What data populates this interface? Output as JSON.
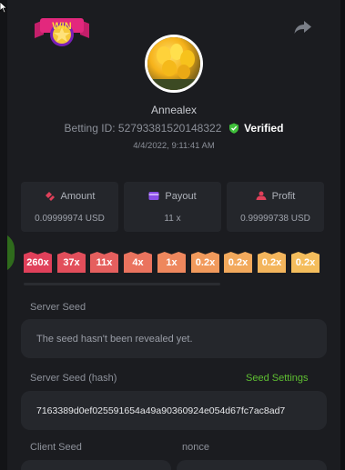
{
  "header": {
    "logo_text": "WIN",
    "share_icon": "share-icon"
  },
  "profile": {
    "username": "Annealex",
    "betting_id_label": "Betting ID:",
    "betting_id": "52793381520148322",
    "verified_label": "Verified",
    "date": "4/4/2022, 9:11:41 AM"
  },
  "stats": [
    {
      "label": "Amount",
      "value": "0.09999974 USD",
      "icon": "coins-icon",
      "color": "#e0405a"
    },
    {
      "label": "Payout",
      "value": "11 x",
      "icon": "card-icon",
      "color": "#8a4ee8"
    },
    {
      "label": "Profit",
      "value": "0.99999738 USD",
      "icon": "money-bag-icon",
      "color": "#e0405a"
    }
  ],
  "multipliers": [
    {
      "label": "260x",
      "color": "#e0405a"
    },
    {
      "label": "37x",
      "color": "#e24e5b"
    },
    {
      "label": "11x",
      "color": "#e55f5e"
    },
    {
      "label": "4x",
      "color": "#ea735e"
    },
    {
      "label": "1x",
      "color": "#ee875d"
    },
    {
      "label": "0.2x",
      "color": "#f19a5c"
    },
    {
      "label": "0.2x",
      "color": "#f2a95c"
    },
    {
      "label": "0.2x",
      "color": "#f3b55c"
    },
    {
      "label": "0.2x",
      "color": "#f4bd5c"
    }
  ],
  "seeds": {
    "server_seed_label": "Server Seed",
    "server_seed_value": "The seed hasn't been revealed yet.",
    "server_hash_label": "Server Seed (hash)",
    "seed_settings_label": "Seed Settings",
    "server_hash_value": "7163389d0ef025591654a49a90360924e054d67fc7ac8ad7",
    "client_seed_label": "Client Seed",
    "nonce_label": "nonce"
  },
  "colors": {
    "accent_green": "#5fbf32",
    "background": "#1b1c20"
  }
}
